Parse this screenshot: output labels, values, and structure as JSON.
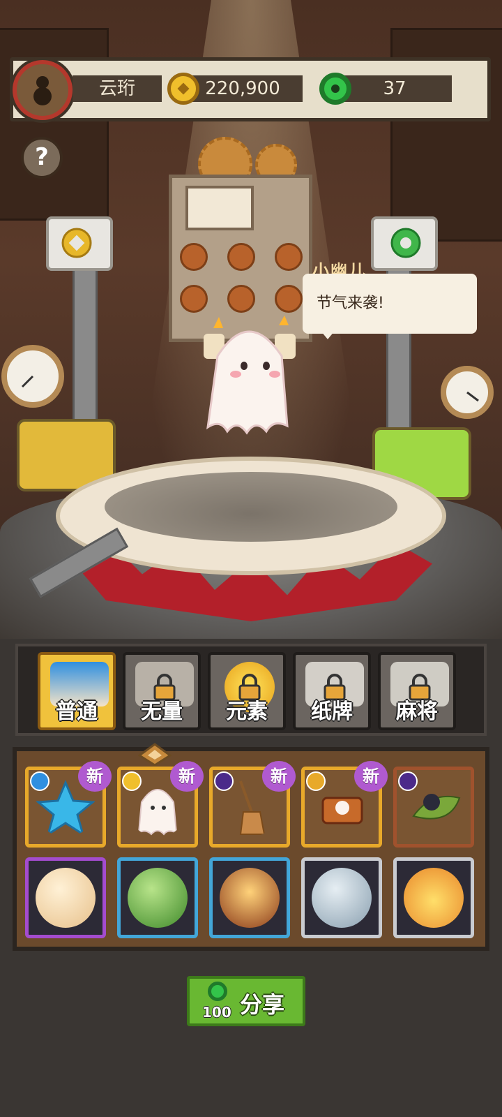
{
  "player": {
    "name": "云珩",
    "gold": "220,900",
    "jade": "37"
  },
  "help": {
    "label": "?"
  },
  "npc": {
    "name": "小幽儿",
    "speech": "节气来袭!"
  },
  "tabs": [
    {
      "label": "普通",
      "locked": false,
      "active": true
    },
    {
      "label": "无量",
      "locked": true,
      "active": false
    },
    {
      "label": "元素",
      "locked": true,
      "active": false
    },
    {
      "label": "纸牌",
      "locked": true,
      "active": false
    },
    {
      "label": "麻将",
      "locked": true,
      "active": false
    }
  ],
  "items_row1": [
    {
      "name": "star-card",
      "badge": "新",
      "frame": "gold"
    },
    {
      "name": "ghost-card",
      "badge": "新",
      "frame": "gold"
    },
    {
      "name": "broom-card",
      "badge": "新",
      "frame": "gold"
    },
    {
      "name": "cake-card",
      "badge": "新",
      "frame": "gold"
    },
    {
      "name": "bomb-leaf-card",
      "badge": "",
      "frame": "brown"
    }
  ],
  "items_row2": [
    {
      "name": "sword-orb",
      "frame": "purple"
    },
    {
      "name": "green-charm-orb",
      "frame": "blue"
    },
    {
      "name": "fire-wok-orb",
      "frame": "blue"
    },
    {
      "name": "blade-orb",
      "frame": "silver"
    },
    {
      "name": "flame-orb",
      "frame": "silver"
    }
  ],
  "share": {
    "label": "分享",
    "cost": "100"
  },
  "colors": {
    "gold_frame": "#e8a92a",
    "new_badge": "#b05ad0",
    "share_green": "#69b832",
    "active_tab": "#f0c23c"
  }
}
